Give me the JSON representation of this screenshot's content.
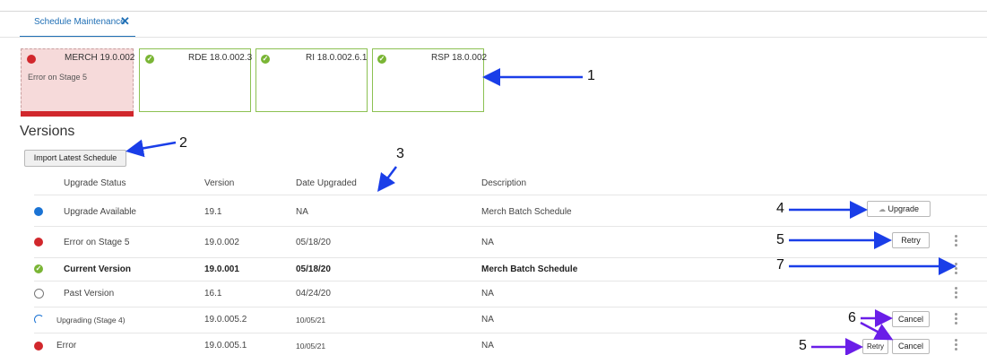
{
  "tab": {
    "label": "Schedule Maintenance",
    "close": "✕"
  },
  "cards": [
    {
      "name": "MERCH 19.0.002",
      "status": "error",
      "subtitle": "Error on Stage 5"
    },
    {
      "name": "RDE 18.0.002.3",
      "status": "ok"
    },
    {
      "name": "RI 18.0.002.6.1",
      "status": "ok"
    },
    {
      "name": "RSP 18.0.002",
      "status": "ok"
    }
  ],
  "versions": {
    "title": "Versions",
    "import_button": "Import Latest Schedule",
    "headers": [
      "Upgrade Status",
      "Version",
      "Date Upgraded",
      "Description"
    ],
    "rows": [
      {
        "status": "Upgrade Available",
        "version": "19.1",
        "date": "NA",
        "description": "Merch Batch Schedule",
        "icon": "blue-dot-icon",
        "actions": [
          "Upgrade"
        ]
      },
      {
        "status": "Error on Stage 5",
        "version": "19.0.002",
        "date": "05/18/20",
        "description": "NA",
        "icon": "red-dot-icon",
        "actions": [
          "Retry"
        ]
      },
      {
        "status": "Current Version",
        "version": "19.0.001",
        "date": "05/18/20",
        "description": "Merch Batch Schedule",
        "icon": "check-icon",
        "actions": []
      },
      {
        "status": "Past Version",
        "version": "16.1",
        "date": "04/24/20",
        "description": "NA",
        "icon": "empty-circle-icon",
        "actions": []
      },
      {
        "status": "Upgrading (Stage 4)",
        "version": "19.0.005.2",
        "date": "10/05/21",
        "description": "NA",
        "icon": "spinner-icon",
        "actions": [
          "Cancel"
        ]
      },
      {
        "status": "Error",
        "version": "19.0.005.1",
        "date": "10/05/21",
        "description": "NA",
        "icon": "red-dot-icon",
        "actions": [
          "Retry",
          "Cancel"
        ]
      }
    ]
  },
  "annotations": [
    "1",
    "2",
    "3",
    "4",
    "5",
    "7",
    "6",
    "5"
  ],
  "colors": {
    "accent": "#1f6fb5",
    "error": "#d1272c",
    "success": "#7ab535",
    "info": "#1a73d4",
    "arrow_blue": "#1a3ee8",
    "arrow_purple": "#6a1ee8"
  }
}
